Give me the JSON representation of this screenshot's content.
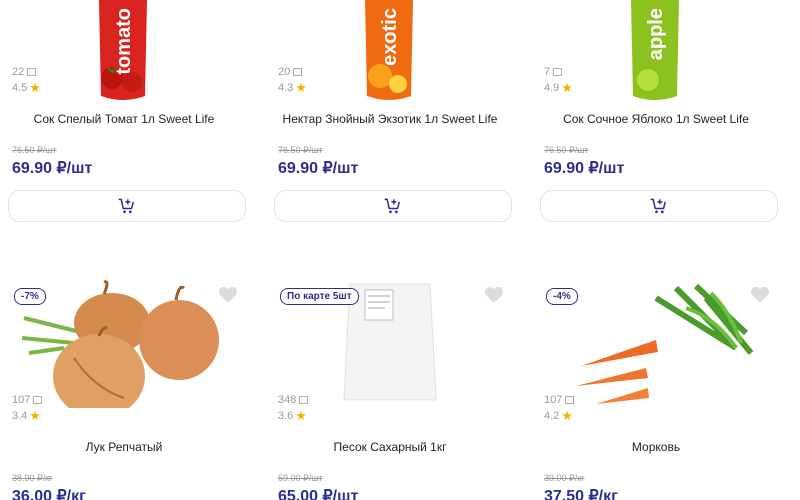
{
  "products_top": [
    {
      "image_icon": "tomato-juice-pack",
      "pack_text": "tomato",
      "pack_color": "#d8231f",
      "reviews": "22",
      "rating": "4.5",
      "name": "Сок Спелый Томат 1л Sweet Life",
      "old_price": "76.50 ₽/шт",
      "price": "69.90 ₽/шт"
    },
    {
      "image_icon": "exotic-nectar-pack",
      "pack_text": "exotic",
      "pack_color": "#f06a12",
      "reviews": "20",
      "rating": "4.3",
      "name": "Нектар Знойный Экзотик 1л Sweet Life",
      "old_price": "76.50 ₽/шт",
      "price": "69.90 ₽/шт"
    },
    {
      "image_icon": "apple-juice-pack",
      "pack_text": "apple",
      "pack_color": "#8cc21f",
      "reviews": "7",
      "rating": "4.9",
      "name": "Сок Сочное Яблоко 1л Sweet Life",
      "old_price": "76.50 ₽/шт",
      "price": "69.90 ₽/шт"
    }
  ],
  "products_bottom": [
    {
      "image_icon": "onion-image",
      "badge": "-7%",
      "reviews": "107",
      "rating": "3.4",
      "name": "Лук Репчатый",
      "old_price": "38.90 ₽/кг",
      "price": "36.00 ₽/кг"
    },
    {
      "image_icon": "sugar-bag-image",
      "badge": "По карте 5шт",
      "reviews": "348",
      "rating": "3.6",
      "name": "Песок Сахарный 1кг",
      "old_price": "69.00 ₽/шт",
      "price": "65.00 ₽/шт"
    },
    {
      "image_icon": "carrot-image",
      "badge": "-4%",
      "reviews": "107",
      "rating": "4.2",
      "name": "Морковь",
      "old_price": "39.00 ₽/кг",
      "price": "37.50 ₽/кг"
    }
  ],
  "colors": {
    "price": "#2d2f8f",
    "star": "#f5b400",
    "badge_border": "#2d2f8f"
  }
}
